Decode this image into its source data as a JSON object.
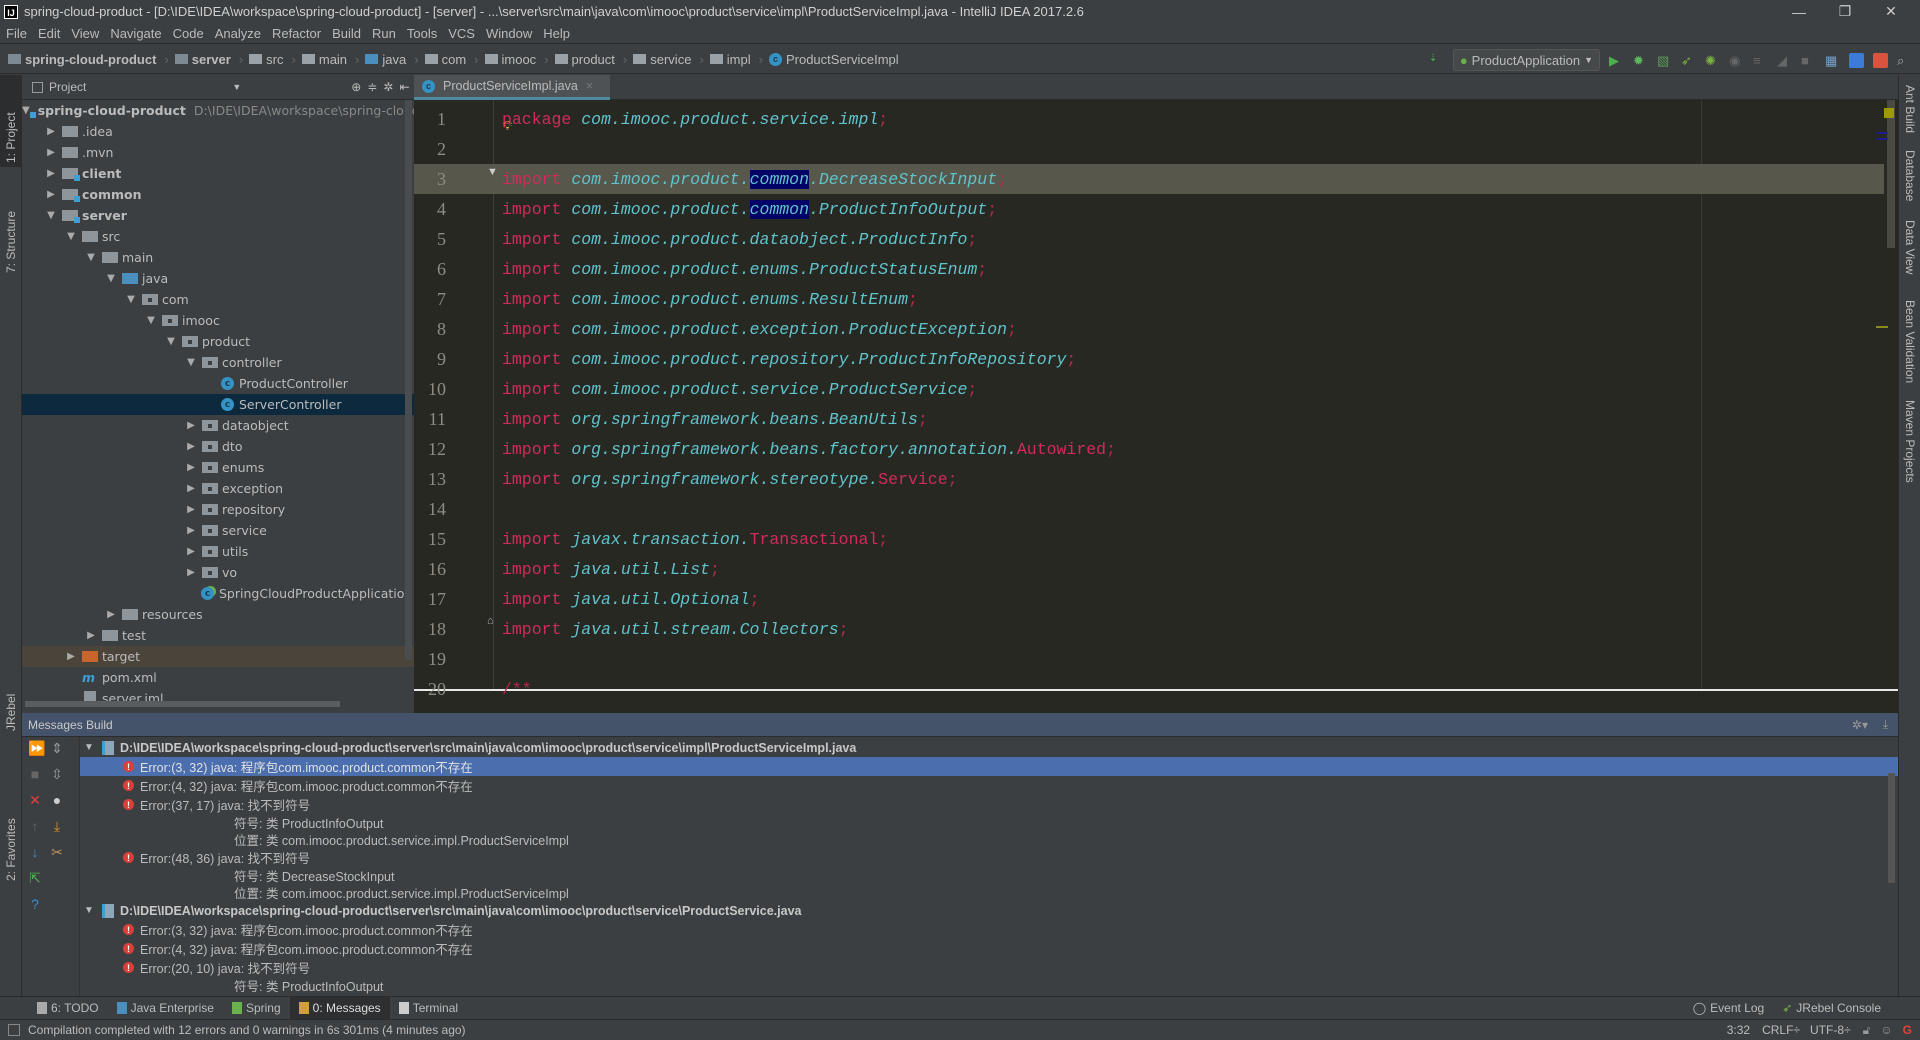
{
  "window": {
    "title": "spring-cloud-product - [D:\\IDE\\IDEA\\workspace\\spring-cloud-product] - [server] - ...\\server\\src\\main\\java\\com\\imooc\\product\\service\\impl\\ProductServiceImpl.java - IntelliJ IDEA 2017.2.6",
    "logo": "IJ"
  },
  "menu": [
    "File",
    "Edit",
    "View",
    "Navigate",
    "Code",
    "Analyze",
    "Refactor",
    "Build",
    "Run",
    "Tools",
    "VCS",
    "Window",
    "Help"
  ],
  "breadcrumbs": [
    {
      "label": "spring-cloud-product",
      "bold": true
    },
    {
      "label": "server",
      "bold": true
    },
    {
      "label": "src"
    },
    {
      "label": "main"
    },
    {
      "label": "java"
    },
    {
      "label": "com"
    },
    {
      "label": "imooc"
    },
    {
      "label": "product"
    },
    {
      "label": "service"
    },
    {
      "label": "impl"
    },
    {
      "label": "ProductServiceImpl",
      "cls": true
    }
  ],
  "run_config": "ProductApplication",
  "left_strip": [
    "1: Project",
    "7: Structure",
    "JRebel",
    "2: Favorites"
  ],
  "right_strip": [
    "Ant Build",
    "Database",
    "Data View",
    "Bean Validation",
    "Maven Projects"
  ],
  "project_panel": {
    "title": "Project",
    "tree": [
      {
        "level": 0,
        "label": "spring-cloud-product",
        "icon": "mod",
        "arrow": "down",
        "bold": true,
        "path": "D:\\IDE\\IDEA\\workspace\\spring-cloud-product"
      },
      {
        "level": 1,
        "label": ".idea",
        "icon": "folder",
        "arrow": "right"
      },
      {
        "level": 1,
        "label": ".mvn",
        "icon": "folder",
        "arrow": "right"
      },
      {
        "level": 1,
        "label": "client",
        "icon": "mod",
        "arrow": "right",
        "bold": true
      },
      {
        "level": 1,
        "label": "common",
        "icon": "mod",
        "arrow": "right",
        "bold": true
      },
      {
        "level": 1,
        "label": "server",
        "icon": "mod",
        "arrow": "down",
        "bold": true
      },
      {
        "level": 2,
        "label": "src",
        "icon": "folder",
        "arrow": "down"
      },
      {
        "level": 3,
        "label": "main",
        "icon": "folder",
        "arrow": "down"
      },
      {
        "level": 4,
        "label": "java",
        "icon": "src",
        "arrow": "down"
      },
      {
        "level": 5,
        "label": "com",
        "icon": "pkg",
        "arrow": "down"
      },
      {
        "level": 6,
        "label": "imooc",
        "icon": "pkg",
        "arrow": "down"
      },
      {
        "level": 7,
        "label": "product",
        "icon": "pkg",
        "arrow": "down"
      },
      {
        "level": 8,
        "label": "controller",
        "icon": "pkg",
        "arrow": "down"
      },
      {
        "level": 9,
        "label": "ProductController",
        "icon": "class"
      },
      {
        "level": 9,
        "label": "ServerController",
        "icon": "class",
        "selected": true
      },
      {
        "level": 8,
        "label": "dataobject",
        "icon": "pkg",
        "arrow": "right"
      },
      {
        "level": 8,
        "label": "dto",
        "icon": "pkg",
        "arrow": "right"
      },
      {
        "level": 8,
        "label": "enums",
        "icon": "pkg",
        "arrow": "right"
      },
      {
        "level": 8,
        "label": "exception",
        "icon": "pkg",
        "arrow": "right"
      },
      {
        "level": 8,
        "label": "repository",
        "icon": "pkg",
        "arrow": "right"
      },
      {
        "level": 8,
        "label": "service",
        "icon": "pkg",
        "arrow": "right"
      },
      {
        "level": 8,
        "label": "utils",
        "icon": "pkg",
        "arrow": "right"
      },
      {
        "level": 8,
        "label": "vo",
        "icon": "pkg",
        "arrow": "right"
      },
      {
        "level": 8,
        "label": "SpringCloudProductApplication",
        "icon": "spring-class"
      },
      {
        "level": 4,
        "label": "resources",
        "icon": "res",
        "arrow": "right"
      },
      {
        "level": 3,
        "label": "test",
        "icon": "folder",
        "arrow": "right"
      },
      {
        "level": 2,
        "label": "target",
        "icon": "excl",
        "arrow": "right",
        "highlight": true
      },
      {
        "level": 2,
        "label": "pom.xml",
        "icon": "maven"
      },
      {
        "level": 2,
        "label": "server.iml",
        "icon": "iml"
      }
    ]
  },
  "editor": {
    "tab": "ProductServiceImpl.java",
    "current_line": 3,
    "lines": [
      [
        [
          "kw",
          "package"
        ],
        [
          "pkg",
          " com.imooc.product.service.impl"
        ],
        [
          "sc",
          ";"
        ]
      ],
      [],
      [
        [
          "kw",
          "import"
        ],
        [
          "pkg",
          " com.imooc.product."
        ],
        [
          "sel",
          "common"
        ],
        [
          "pkg",
          ".DecreaseStockInput"
        ],
        [
          "sc",
          ";"
        ]
      ],
      [
        [
          "kw",
          "import"
        ],
        [
          "pkg",
          " com.imooc.product."
        ],
        [
          "sel",
          "common"
        ],
        [
          "pkg",
          ".ProductInfoOutput"
        ],
        [
          "sc",
          ";"
        ]
      ],
      [
        [
          "kw",
          "import"
        ],
        [
          "pkg",
          " com.imooc.product.dataobject.ProductInfo"
        ],
        [
          "sc",
          ";"
        ]
      ],
      [
        [
          "kw",
          "import"
        ],
        [
          "pkg",
          " com.imooc.product.enums.ProductStatusEnum"
        ],
        [
          "sc",
          ";"
        ]
      ],
      [
        [
          "kw",
          "import"
        ],
        [
          "pkg",
          " com.imooc.product.enums.ResultEnum"
        ],
        [
          "sc",
          ";"
        ]
      ],
      [
        [
          "kw",
          "import"
        ],
        [
          "pkg",
          " com.imooc.product.exception.ProductException"
        ],
        [
          "sc",
          ";"
        ]
      ],
      [
        [
          "kw",
          "import"
        ],
        [
          "pkg",
          " com.imooc.product.repository.ProductInfoRepository"
        ],
        [
          "sc",
          ";"
        ]
      ],
      [
        [
          "kw",
          "import"
        ],
        [
          "pkg",
          " com.imooc.product.service.ProductService"
        ],
        [
          "sc",
          ";"
        ]
      ],
      [
        [
          "kw",
          "import"
        ],
        [
          "pkg",
          " org.springframework.beans.BeanUtils"
        ],
        [
          "sc",
          ";"
        ]
      ],
      [
        [
          "kw",
          "import"
        ],
        [
          "pkg",
          " org.springframework.beans.factory.annotation."
        ],
        [
          "ann",
          "Autowired"
        ],
        [
          "sc",
          ";"
        ]
      ],
      [
        [
          "kw",
          "import"
        ],
        [
          "pkg",
          " org.springframework.stereotype."
        ],
        [
          "ann",
          "Service"
        ],
        [
          "sc",
          ";"
        ]
      ],
      [],
      [
        [
          "kw",
          "import"
        ],
        [
          "pkg",
          " javax.transaction."
        ],
        [
          "ann",
          "Transactional"
        ],
        [
          "sc",
          ";"
        ]
      ],
      [
        [
          "kw",
          "import"
        ],
        [
          "pkg",
          " java.util.List"
        ],
        [
          "sc",
          ";"
        ]
      ],
      [
        [
          "kw",
          "import"
        ],
        [
          "pkg",
          " java.util.Optional"
        ],
        [
          "sc",
          ";"
        ]
      ],
      [
        [
          "kw",
          "import"
        ],
        [
          "pkg",
          " java.util.stream.Collectors"
        ],
        [
          "sc",
          ";"
        ]
      ],
      [],
      [
        [
          "sc",
          "/**"
        ]
      ]
    ]
  },
  "messages": {
    "title": "Messages Build",
    "rows": [
      {
        "type": "file",
        "text": "D:\\IDE\\IDEA\\workspace\\spring-cloud-product\\server\\src\\main\\java\\com\\imooc\\product\\service\\impl\\ProductServiceImpl.java"
      },
      {
        "type": "error",
        "text": "Error:(3, 32)  java: 程序包com.imooc.product.common不存在",
        "selected": true
      },
      {
        "type": "error",
        "text": "Error:(4, 32)  java: 程序包com.imooc.product.common不存在"
      },
      {
        "type": "error",
        "text": "Error:(37, 17)  java: 找不到符号"
      },
      {
        "type": "detail",
        "text": "符号:   类 ProductInfoOutput"
      },
      {
        "type": "detail",
        "text": "位置: 类 com.imooc.product.service.impl.ProductServiceImpl"
      },
      {
        "type": "error",
        "text": "Error:(48, 36)  java: 找不到符号"
      },
      {
        "type": "detail",
        "text": "符号:   类 DecreaseStockInput"
      },
      {
        "type": "detail",
        "text": "位置: 类 com.imooc.product.service.impl.ProductServiceImpl"
      },
      {
        "type": "file",
        "text": "D:\\IDE\\IDEA\\workspace\\spring-cloud-product\\server\\src\\main\\java\\com\\imooc\\product\\service\\ProductService.java"
      },
      {
        "type": "error",
        "text": "Error:(3, 32)  java: 程序包com.imooc.product.common不存在"
      },
      {
        "type": "error",
        "text": "Error:(4, 32)  java: 程序包com.imooc.product.common不存在"
      },
      {
        "type": "error",
        "text": "Error:(20, 10)  java: 找不到符号"
      },
      {
        "type": "detail",
        "text": "符号:   类 ProductInfoOutput"
      }
    ]
  },
  "bottom_tabs": [
    {
      "label": "6: TODO",
      "icon": "todo-icon"
    },
    {
      "label": "Java Enterprise",
      "icon": "java-enterprise-icon"
    },
    {
      "label": "Spring",
      "icon": "spring-icon"
    },
    {
      "label": "0: Messages",
      "icon": "messages-icon",
      "active": true
    },
    {
      "label": "Terminal",
      "icon": "terminal-icon"
    }
  ],
  "bottom_right_tabs": [
    "Event Log",
    "JRebel Console"
  ],
  "status": {
    "message": "Compilation completed with 12 errors and 0 warnings in 6s 301ms (4 minutes ago)",
    "position": "3:32",
    "line_sep": "CRLF÷",
    "encoding": "UTF-8÷"
  }
}
